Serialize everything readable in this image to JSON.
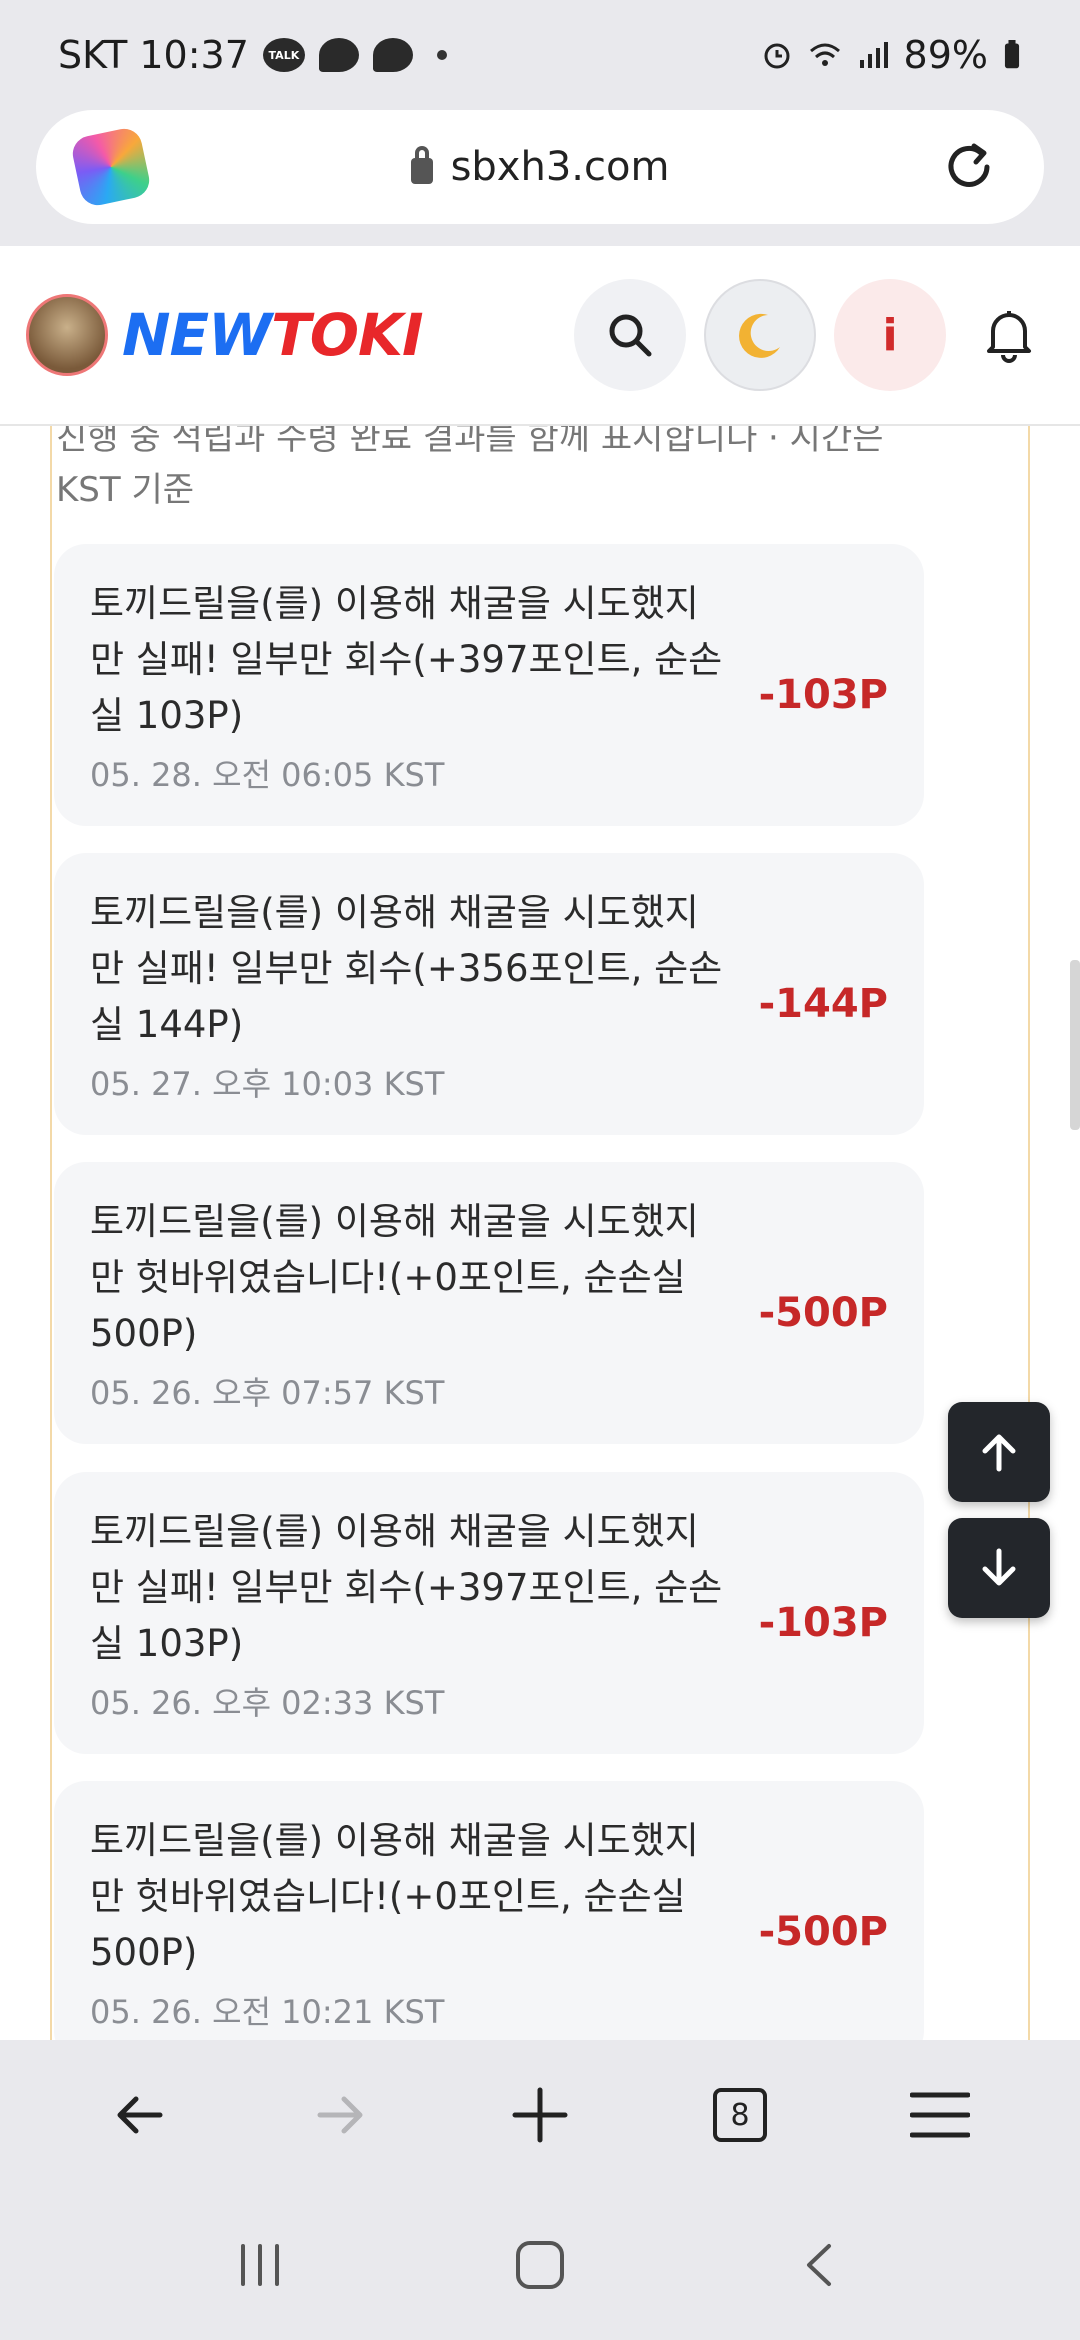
{
  "status": {
    "carrier_time": "SKT 10:37",
    "talk_label": "TALK",
    "battery": "89%"
  },
  "browser": {
    "url": "sbxh3.com",
    "tabs_count": "8"
  },
  "site": {
    "logo_part1": "NEW",
    "logo_part2": "TOKI",
    "info_label": "i"
  },
  "content": {
    "intro": "진행 중 적립과 수령 완료 결과를 함께 표시합니다 · 시간은 KST 기준",
    "entries": [
      {
        "message": "토끼드릴을(를) 이용해 채굴을 시도했지만 실패! 일부만 회수(+397포인트, 순손실 103P)",
        "time": "05. 28. 오전 06:05 KST",
        "amount": "-103P"
      },
      {
        "message": "토끼드릴을(를) 이용해 채굴을 시도했지만 실패! 일부만 회수(+356포인트, 순손실 144P)",
        "time": "05. 27. 오후 10:03 KST",
        "amount": "-144P"
      },
      {
        "message": "토끼드릴을(를) 이용해 채굴을 시도했지만 헛바위였습니다!(+0포인트, 순손실 500P)",
        "time": "05. 26. 오후 07:57 KST",
        "amount": "-500P"
      },
      {
        "message": "토끼드릴을(를) 이용해 채굴을 시도했지만 실패! 일부만 회수(+397포인트, 순손실 103P)",
        "time": "05. 26. 오후 02:33 KST",
        "amount": "-103P"
      },
      {
        "message": "토끼드릴을(를) 이용해 채굴을 시도했지만 헛바위였습니다!(+0포인트, 순손실 500P)",
        "time": "05. 26. 오전 10:21 KST",
        "amount": "-500P"
      }
    ]
  },
  "colors": {
    "brand_blue": "#1c6ef2",
    "brand_red": "#e8272a",
    "loss_red": "#c62828",
    "panel_border": "#f3d9a8"
  },
  "icons": [
    "copilot-icon",
    "lock-icon",
    "reload-icon",
    "search-icon",
    "moon-icon",
    "bell-icon",
    "arrow-up-icon",
    "arrow-down-icon",
    "back-icon",
    "forward-icon",
    "plus-icon",
    "menu-icon",
    "recents-icon",
    "home-icon",
    "nav-back-icon"
  ]
}
